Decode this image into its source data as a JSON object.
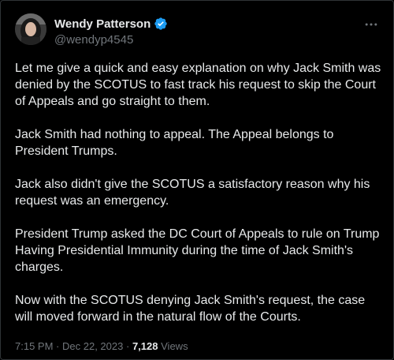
{
  "author": {
    "display_name": "Wendy Patterson",
    "handle": "@wendyp4545",
    "verified_color": "#1d9bf0"
  },
  "tweet": {
    "paragraphs": [
      "Let me give a quick and easy explanation on why Jack Smith was denied by the SCOTUS to fast track his request to skip the Court of Appeals and go straight to them.",
      "Jack Smith had nothing to appeal.  The Appeal belongs to President Trumps.",
      "Jack also didn't give the SCOTUS a satisfactory reason why his request was an emergency.",
      "President Trump asked the DC Court of Appeals to rule on Trump Having Presidential Immunity during the time of Jack Smith's charges.",
      "Now with the SCOTUS denying Jack Smith's request, the case will moved forward in the natural flow of the Courts."
    ],
    "time": "7:15 PM",
    "separator": "·",
    "date": "Dec 22, 2023",
    "views_count": "7,128",
    "views_label": "Views"
  },
  "icons": {
    "more": "more-horizontal-icon",
    "verified": "verified-badge-icon"
  }
}
